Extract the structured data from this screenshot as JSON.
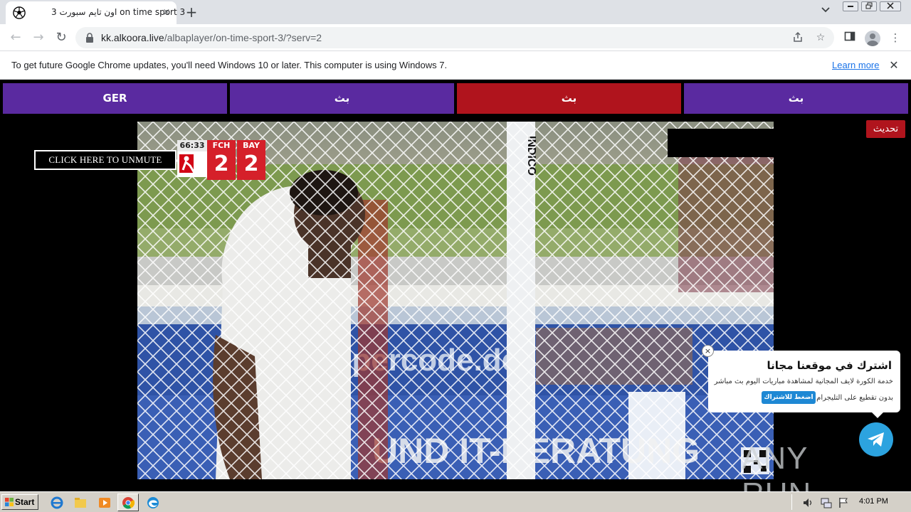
{
  "browser": {
    "tab_title": "اون تايم سبورت 3 on time sport 3",
    "url_host": "kk.alkoora.live",
    "url_path": "/albaplayer/on-time-sport-3/?serv=2",
    "new_tab": "+",
    "tab_close": "×"
  },
  "infobar": {
    "message": "To get future Google Chrome updates, you'll need Windows 10 or later. This computer is using Windows 7.",
    "link": "Learn more",
    "close": "✕"
  },
  "page": {
    "server_tabs": [
      "GER",
      "بث",
      "بث",
      "بث"
    ],
    "active_tab_index": 2,
    "refresh_label": "تحديث",
    "unmute_label": "CLICK HERE TO UNMUTE",
    "scoreboard": {
      "clock": "66:33",
      "home_team": "FCH",
      "home_score": "2",
      "away_team": "BAY",
      "away_score": "2"
    },
    "telegram_popup": {
      "title": "اشترك في موقعنا مجانا",
      "line1": "خدمة الكورة لايف المجانية لمشاهدة مباريات اليوم بث مباشر",
      "line2": "بدون تقطيع على التليجرام",
      "button": "اضغط للاشتراك",
      "close": "×"
    },
    "watermark": "ANY RUN"
  },
  "taskbar": {
    "start_label": "Start",
    "clock": "4:01 PM"
  },
  "colors": {
    "server_tab": "#5a2aa0",
    "server_tab_active": "#b0141d",
    "telegram": "#2ca3df"
  }
}
